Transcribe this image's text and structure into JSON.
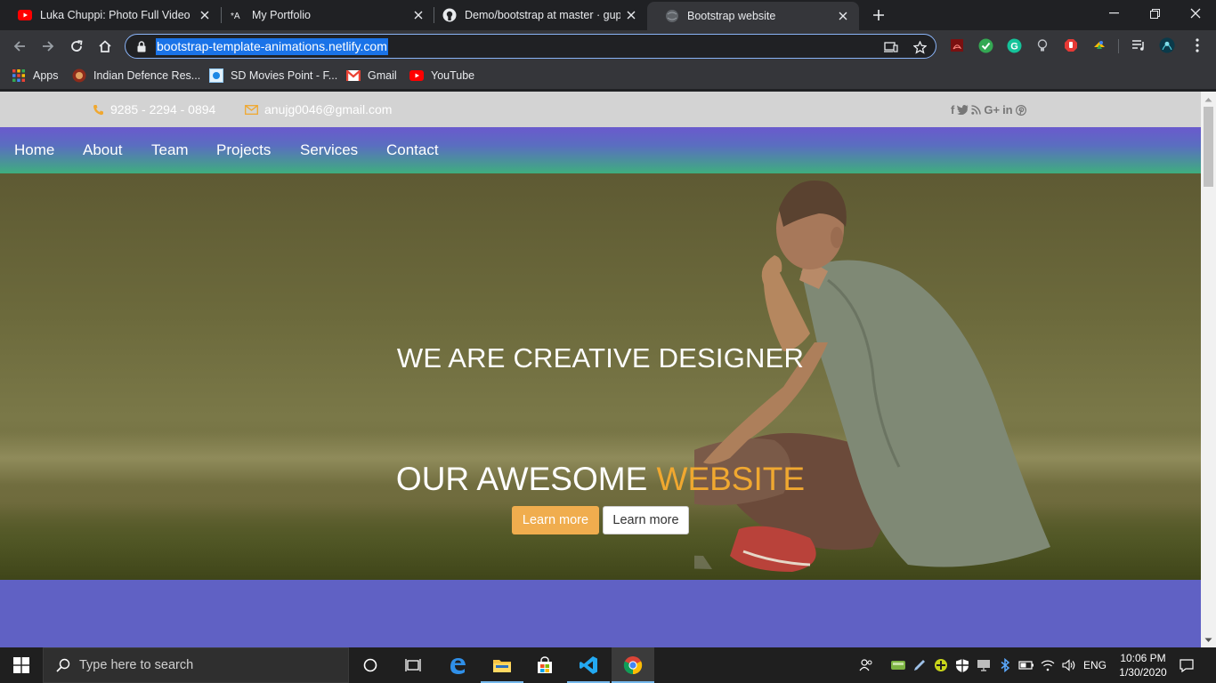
{
  "browser": {
    "tabs": [
      {
        "title": "Luka Chuppi: Photo Full Video | K",
        "favicon": "youtube-icon"
      },
      {
        "title": "My Portfolio",
        "favicon": "portfolio-icon"
      },
      {
        "title": "Demo/bootstrap at master · gupt",
        "favicon": "github-icon"
      },
      {
        "title": "Bootstrap website",
        "favicon": "globe-icon"
      }
    ],
    "url": "bootstrap-template-animations.netlify.com",
    "bookmarks": [
      {
        "label": "Apps",
        "icon": "apps-grid-icon"
      },
      {
        "label": "Indian Defence Res...",
        "icon": "defence-icon"
      },
      {
        "label": "SD Movies Point - F...",
        "icon": "movies-icon"
      },
      {
        "label": "Gmail",
        "icon": "gmail-icon"
      },
      {
        "label": "YouTube",
        "icon": "youtube-icon"
      }
    ]
  },
  "page": {
    "topbar": {
      "phone": "9285 - 2294 - 0894",
      "email": "anujg0046@gmail.com",
      "social": [
        "f",
        "t",
        "rss",
        "G+",
        "in",
        "p"
      ]
    },
    "nav": [
      "Home",
      "About",
      "Team",
      "Projects",
      "Services",
      "Contact"
    ],
    "hero": {
      "line1": "WE ARE CREATIVE DESIGNER",
      "line2_main": "OUR AWESOME",
      "line2_accent": "WEBSITE",
      "btn_primary": "Learn more",
      "btn_secondary": "Learn more",
      "slides": 2,
      "active_slide": 1
    },
    "colors": {
      "accent": "#f0a830",
      "nav_top": "#6a5acd",
      "nav_bottom": "#3fae7e",
      "section": "#6061c4"
    }
  },
  "taskbar": {
    "search_placeholder": "Type here to search",
    "language": "ENG",
    "time": "10:06 PM",
    "date": "1/30/2020"
  }
}
